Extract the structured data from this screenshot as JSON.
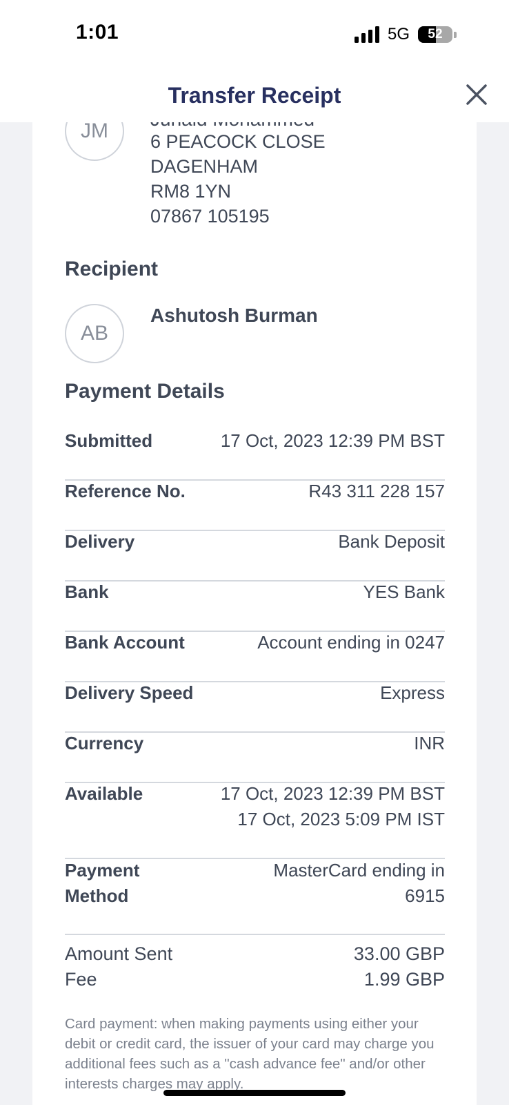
{
  "status_bar": {
    "time": "1:01",
    "network": "5G",
    "battery": "52"
  },
  "header": {
    "title": "Transfer Receipt"
  },
  "sender": {
    "initials": "JM",
    "name": "Junaid Mohammed",
    "address_lines": [
      "6 PEACOCK CLOSE",
      "DAGENHAM",
      "RM8 1YN",
      "07867 105195"
    ]
  },
  "recipient": {
    "section_title": "Recipient",
    "initials": "AB",
    "name": "Ashutosh Burman"
  },
  "payment_details": {
    "section_title": "Payment Details",
    "rows": [
      {
        "label": "Submitted",
        "value": "17 Oct, 2023 12:39 PM BST"
      },
      {
        "label": "Reference No.",
        "value": "R43 311 228 157"
      },
      {
        "label": "Delivery",
        "value": "Bank Deposit"
      },
      {
        "label": "Bank",
        "value": "YES Bank"
      },
      {
        "label": "Bank Account",
        "value": "Account ending in 0247"
      },
      {
        "label": "Delivery Speed",
        "value": "Express"
      },
      {
        "label": "Currency",
        "value": "INR"
      },
      {
        "label": "Available",
        "value": "17 Oct, 2023 12:39 PM BST",
        "value2": "17 Oct, 2023 5:09 PM IST"
      },
      {
        "label": "Payment",
        "label2": "Method",
        "value": "MasterCard ending in",
        "value2": "6915"
      }
    ]
  },
  "amounts": [
    {
      "label": "Amount Sent",
      "value": "33.00 GBP"
    },
    {
      "label": "Fee",
      "value": "1.99 GBP"
    }
  ],
  "note": "Card payment: when making payments using either your debit or credit card, the issuer of your card may charge you additional fees such as a \"cash advance fee\" and/or other interests charges may apply."
}
